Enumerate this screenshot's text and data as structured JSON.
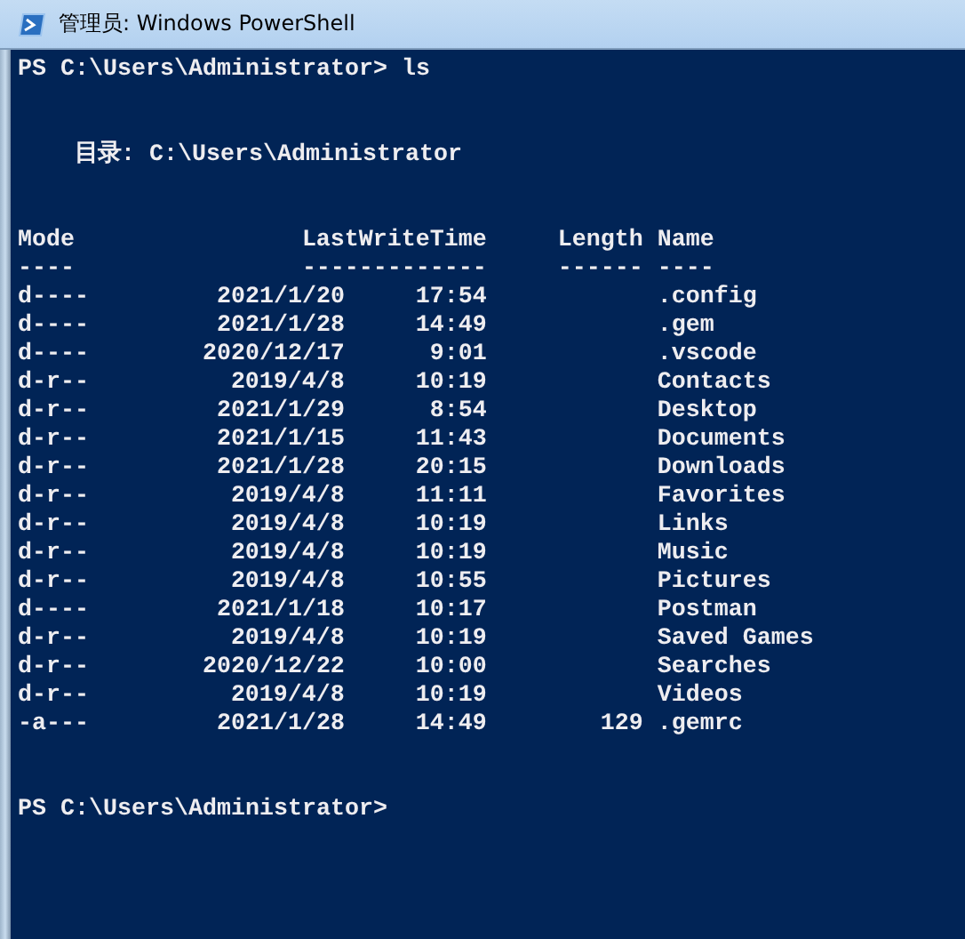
{
  "window": {
    "title": "管理员: Windows PowerShell"
  },
  "console": {
    "command_line": "PS C:\\Users\\Administrator> ls",
    "directory_line": "目录: C:\\Users\\Administrator",
    "columns": [
      "Mode",
      "LastWriteTime",
      "Length",
      "Name"
    ],
    "column_rules": [
      "----",
      "-------------",
      "------",
      "----"
    ],
    "rows": [
      {
        "mode": "d----",
        "date": "2021/1/20",
        "time": "17:54",
        "length": "",
        "name": ".config"
      },
      {
        "mode": "d----",
        "date": "2021/1/28",
        "time": "14:49",
        "length": "",
        "name": ".gem"
      },
      {
        "mode": "d----",
        "date": "2020/12/17",
        "time": "9:01",
        "length": "",
        "name": ".vscode"
      },
      {
        "mode": "d-r--",
        "date": "2019/4/8",
        "time": "10:19",
        "length": "",
        "name": "Contacts"
      },
      {
        "mode": "d-r--",
        "date": "2021/1/29",
        "time": "8:54",
        "length": "",
        "name": "Desktop"
      },
      {
        "mode": "d-r--",
        "date": "2021/1/15",
        "time": "11:43",
        "length": "",
        "name": "Documents"
      },
      {
        "mode": "d-r--",
        "date": "2021/1/28",
        "time": "20:15",
        "length": "",
        "name": "Downloads"
      },
      {
        "mode": "d-r--",
        "date": "2019/4/8",
        "time": "11:11",
        "length": "",
        "name": "Favorites"
      },
      {
        "mode": "d-r--",
        "date": "2019/4/8",
        "time": "10:19",
        "length": "",
        "name": "Links"
      },
      {
        "mode": "d-r--",
        "date": "2019/4/8",
        "time": "10:19",
        "length": "",
        "name": "Music"
      },
      {
        "mode": "d-r--",
        "date": "2019/4/8",
        "time": "10:55",
        "length": "",
        "name": "Pictures"
      },
      {
        "mode": "d----",
        "date": "2021/1/18",
        "time": "10:17",
        "length": "",
        "name": "Postman"
      },
      {
        "mode": "d-r--",
        "date": "2019/4/8",
        "time": "10:19",
        "length": "",
        "name": "Saved Games"
      },
      {
        "mode": "d-r--",
        "date": "2020/12/22",
        "time": "10:00",
        "length": "",
        "name": "Searches"
      },
      {
        "mode": "d-r--",
        "date": "2019/4/8",
        "time": "10:19",
        "length": "",
        "name": "Videos"
      },
      {
        "mode": "-a---",
        "date": "2021/1/28",
        "time": "14:49",
        "length": "129",
        "name": ".gemrc"
      }
    ],
    "prompt": "PS C:\\Users\\Administrator>"
  }
}
